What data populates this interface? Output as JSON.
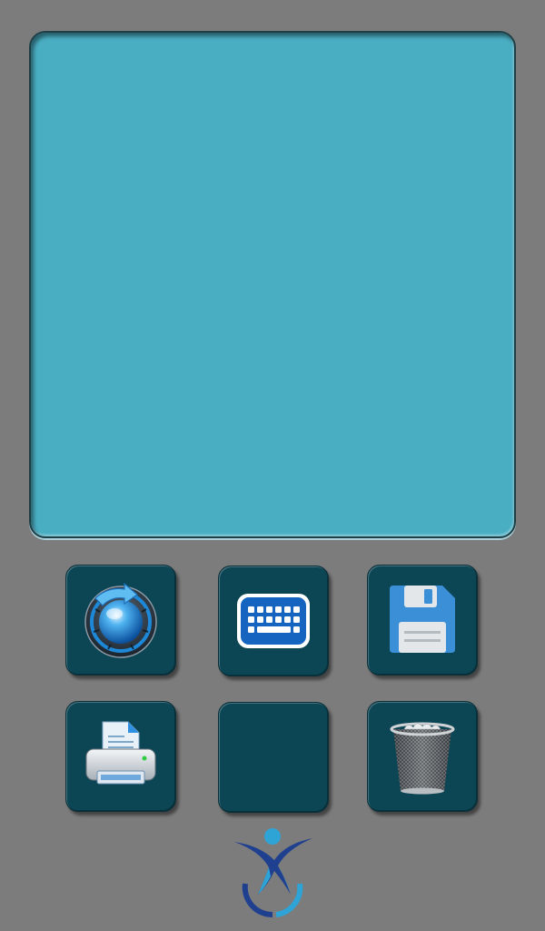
{
  "toolbar": {
    "buttons": [
      {
        "id": "refresh",
        "icon": "refresh-icon"
      },
      {
        "id": "keyboard",
        "icon": "keyboard-icon"
      },
      {
        "id": "save",
        "icon": "floppy-disk-icon"
      },
      {
        "id": "print",
        "icon": "printer-icon"
      },
      {
        "id": "blank",
        "icon": ""
      },
      {
        "id": "trash",
        "icon": "trash-bin-icon"
      }
    ]
  },
  "colors": {
    "background": "#7c7c7c",
    "canvas": "#4aaec3",
    "tile": "#0c4554",
    "accent_blue": "#1e88d8",
    "logo_dark": "#1f3f8f",
    "logo_light": "#2ea3d6"
  }
}
